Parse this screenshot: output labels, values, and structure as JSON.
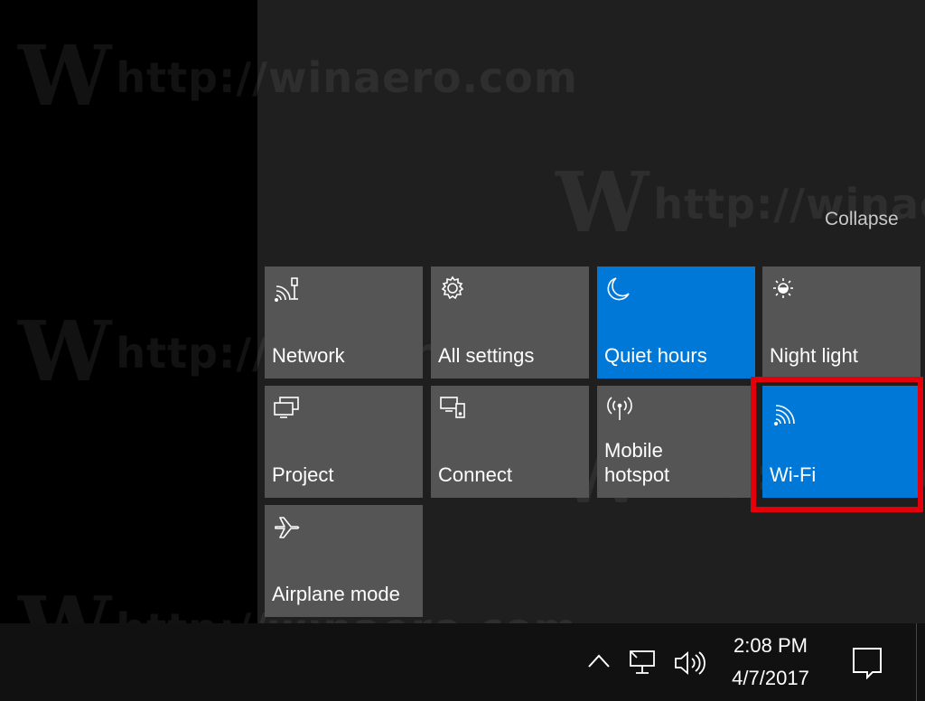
{
  "action_center": {
    "collapse_label": "Collapse",
    "tiles": [
      {
        "label": "Network",
        "icon": "network-icon",
        "active": false
      },
      {
        "label": "All settings",
        "icon": "gear-icon",
        "active": false
      },
      {
        "label": "Quiet hours",
        "icon": "moon-icon",
        "active": true
      },
      {
        "label": "Night light",
        "icon": "brightness-icon",
        "active": false
      },
      {
        "label": "Project",
        "icon": "project-icon",
        "active": false
      },
      {
        "label": "Connect",
        "icon": "connect-icon",
        "active": false
      },
      {
        "label": "Mobile\nhotspot",
        "icon": "hotspot-icon",
        "active": false
      },
      {
        "label": "Wi-Fi",
        "icon": "wifi-icon",
        "active": true
      },
      {
        "label": "Airplane mode",
        "icon": "airplane-icon",
        "active": false
      }
    ]
  },
  "taskbar": {
    "time": "2:08 PM",
    "date": "4/7/2017",
    "tray_icons": [
      "chevron-up-icon",
      "network-icon",
      "volume-icon"
    ],
    "notification_icon": "action-center-icon"
  },
  "watermark": "http://winaero.com",
  "colors": {
    "tile_active": "#0078d7",
    "tile_inactive": "#555555",
    "panel_bg": "#1f1f1f",
    "highlight": "#e3000b"
  }
}
